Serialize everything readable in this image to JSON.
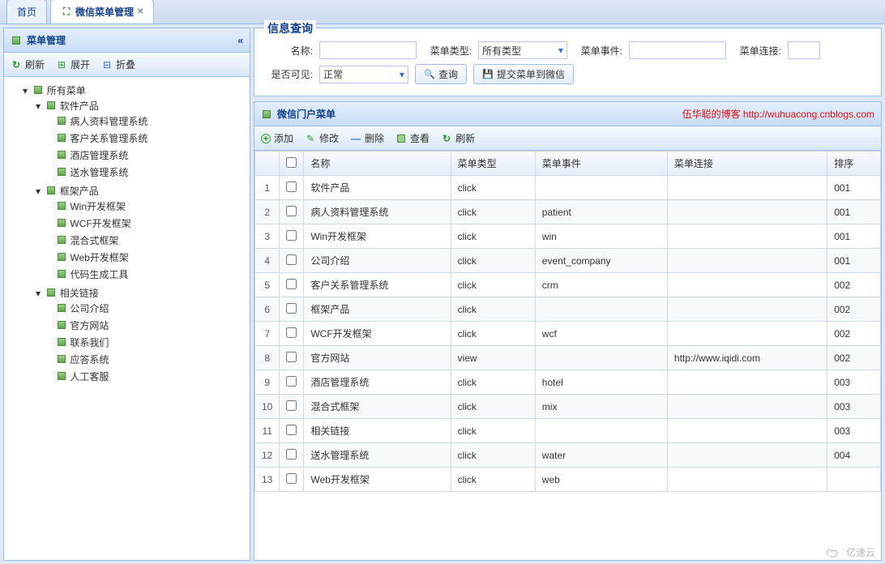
{
  "tabs": {
    "home": "首页",
    "mgmt": "微信菜单管理"
  },
  "sidebar": {
    "title": "菜单管理",
    "tools": {
      "refresh": "刷新",
      "expand": "展开",
      "collapse": "折叠"
    },
    "root": "所有菜单",
    "groups": [
      {
        "label": "软件产品",
        "children": [
          "病人资料管理系统",
          "客户关系管理系统",
          "酒店管理系统",
          "送水管理系统"
        ]
      },
      {
        "label": "框架产品",
        "children": [
          "Win开发框架",
          "WCF开发框架",
          "混合式框架",
          "Web开发框架",
          "代码生成工具"
        ]
      },
      {
        "label": "相关链接",
        "children": [
          "公司介绍",
          "官方网站",
          "联系我们",
          "应答系统",
          "人工客服"
        ]
      }
    ]
  },
  "query": {
    "title": "信息查询",
    "labels": {
      "name": "名称:",
      "type": "菜单类型:",
      "event": "菜单事件:",
      "link": "菜单连接:",
      "visible": "是否可见:"
    },
    "type_value": "所有类型",
    "visible_value": "正常",
    "search_btn": "查询",
    "submit_btn": "提交菜单到微信"
  },
  "grid": {
    "title": "微信门户菜单",
    "watermark": "伍华聪的博客 http://wuhuacong.cnblogs.com",
    "tools": {
      "add": "添加",
      "edit": "修改",
      "del": "删除",
      "view": "查看",
      "refresh": "刷新"
    },
    "cols": {
      "name": "名称",
      "type": "菜单类型",
      "event": "菜单事件",
      "link": "菜单连接",
      "order": "排序"
    },
    "rows": [
      {
        "name": "软件产品",
        "type": "click",
        "event": "",
        "link": "",
        "order": "001"
      },
      {
        "name": "病人资料管理系统",
        "type": "click",
        "event": "patient",
        "link": "",
        "order": "001"
      },
      {
        "name": "Win开发框架",
        "type": "click",
        "event": "win",
        "link": "",
        "order": "001"
      },
      {
        "name": "公司介绍",
        "type": "click",
        "event": "event_company",
        "link": "",
        "order": "001"
      },
      {
        "name": "客户关系管理系统",
        "type": "click",
        "event": "crm",
        "link": "",
        "order": "002"
      },
      {
        "name": "框架产品",
        "type": "click",
        "event": "",
        "link": "",
        "order": "002"
      },
      {
        "name": "WCF开发框架",
        "type": "click",
        "event": "wcf",
        "link": "",
        "order": "002"
      },
      {
        "name": "官方网站",
        "type": "view",
        "event": "",
        "link": "http://www.iqidi.com",
        "order": "002"
      },
      {
        "name": "酒店管理系统",
        "type": "click",
        "event": "hotel",
        "link": "",
        "order": "003"
      },
      {
        "name": "混合式框架",
        "type": "click",
        "event": "mix",
        "link": "",
        "order": "003"
      },
      {
        "name": "相关链接",
        "type": "click",
        "event": "",
        "link": "",
        "order": "003"
      },
      {
        "name": "送水管理系统",
        "type": "click",
        "event": "water",
        "link": "",
        "order": "004"
      },
      {
        "name": "Web开发框架",
        "type": "click",
        "event": "web",
        "link": "",
        "order": ""
      }
    ]
  },
  "footer_badge": "亿速云"
}
